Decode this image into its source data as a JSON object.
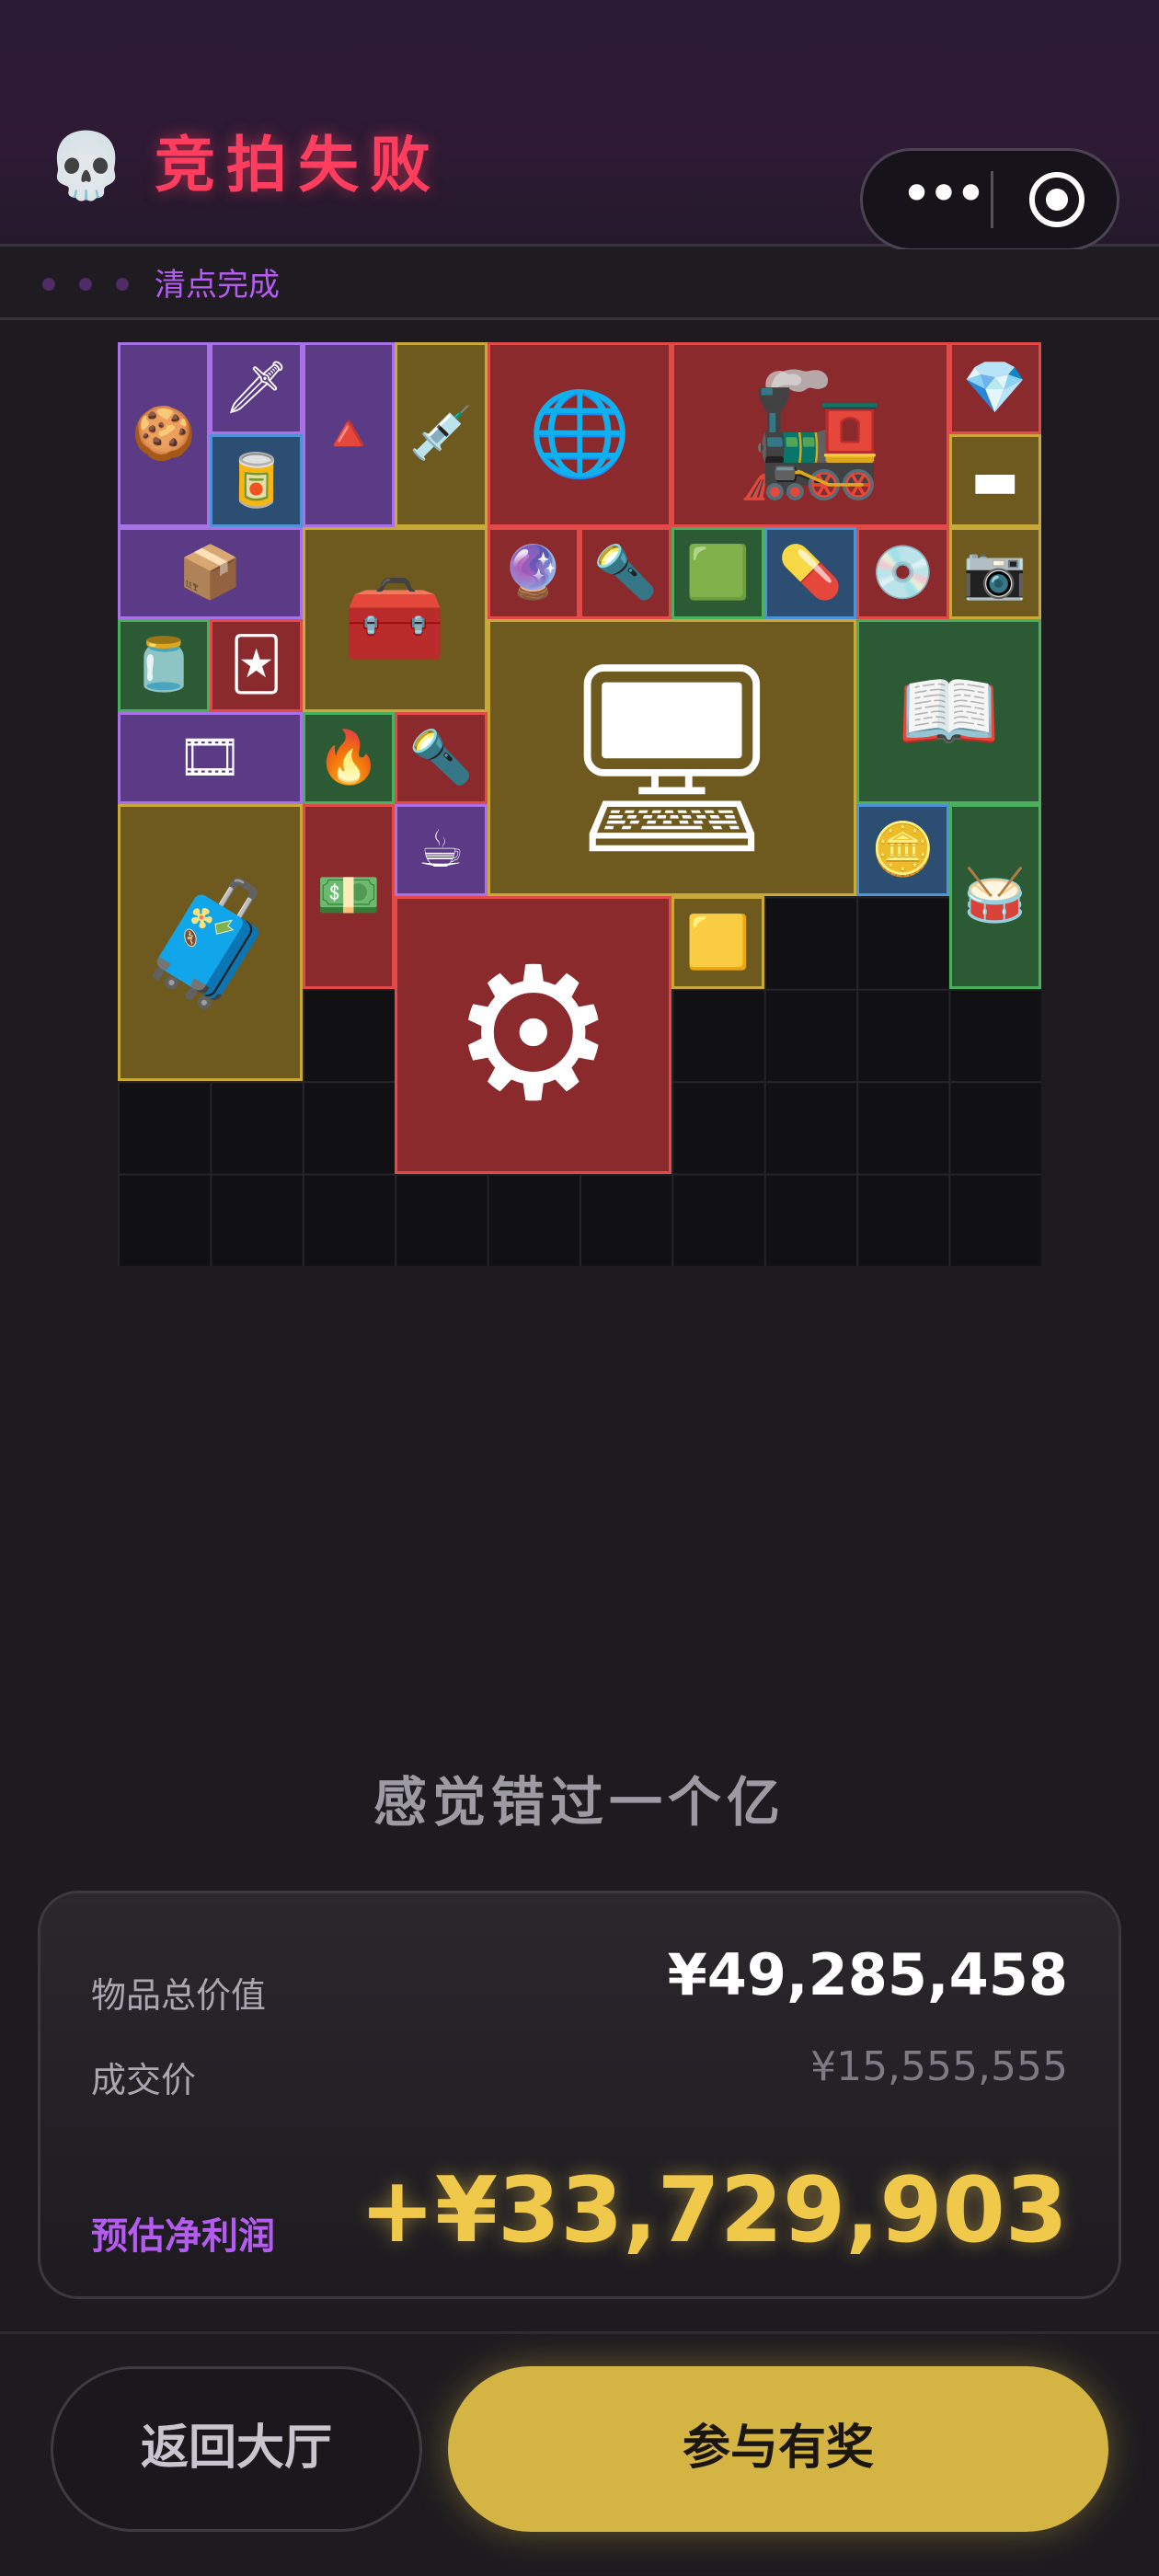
{
  "header": {
    "skull_icon": "💀",
    "title": "竞拍失败",
    "capsule_more": "•••"
  },
  "status": {
    "text": "清点完成"
  },
  "grid": {
    "items": [
      {
        "name": "gingerbread",
        "glyph": "🍪",
        "color": "purple"
      },
      {
        "name": "spearhead",
        "glyph": "🗡",
        "color": "purple"
      },
      {
        "name": "triangle-pendant",
        "glyph": "🔺",
        "color": "purple"
      },
      {
        "name": "capsule-case",
        "glyph": "💉",
        "color": "gold"
      },
      {
        "name": "armillary-sphere",
        "glyph": "🌐",
        "color": "red"
      },
      {
        "name": "red-engine",
        "glyph": "🚂",
        "color": "red"
      },
      {
        "name": "diamond",
        "glyph": "💎",
        "color": "red"
      },
      {
        "name": "ammo-tin",
        "glyph": "🥫",
        "color": "blue"
      },
      {
        "name": "chip-bar",
        "glyph": "▬",
        "color": "gold"
      },
      {
        "name": "gpu-box",
        "glyph": "📦",
        "color": "purple"
      },
      {
        "name": "ammo-crate",
        "glyph": "🧰",
        "color": "gold"
      },
      {
        "name": "marble-orb",
        "glyph": "🔮",
        "color": "red"
      },
      {
        "name": "flashlight",
        "glyph": "🔦",
        "color": "red"
      },
      {
        "name": "circuit-board",
        "glyph": "🟩",
        "color": "green"
      },
      {
        "name": "pill-bottle",
        "glyph": "💊",
        "color": "blue"
      },
      {
        "name": "cd-disc",
        "glyph": "💿",
        "color": "red"
      },
      {
        "name": "camera",
        "glyph": "📷",
        "color": "gold"
      },
      {
        "name": "coffee-jar",
        "glyph": "🫙",
        "color": "green"
      },
      {
        "name": "playing-card",
        "glyph": "🃏",
        "color": "red"
      },
      {
        "name": "server-board",
        "glyph": "🖥",
        "color": "gold"
      },
      {
        "name": "magazine",
        "glyph": "📖",
        "color": "green"
      },
      {
        "name": "graphics-card",
        "glyph": "🎞",
        "color": "purple"
      },
      {
        "name": "lighter",
        "glyph": "🔥",
        "color": "green"
      },
      {
        "name": "flashlight-2",
        "glyph": "🔦",
        "color": "red"
      },
      {
        "name": "hard-case",
        "glyph": "🧳",
        "color": "gold"
      },
      {
        "name": "banknote",
        "glyph": "💵",
        "color": "red"
      },
      {
        "name": "teacup",
        "glyph": "☕",
        "color": "purple"
      },
      {
        "name": "coin",
        "glyph": "🪙",
        "color": "blue"
      },
      {
        "name": "djembe-drum",
        "glyph": "🥁",
        "color": "green"
      },
      {
        "name": "engine-unit",
        "glyph": "⚙",
        "color": "red"
      },
      {
        "name": "gold-lighter",
        "glyph": "🟨",
        "color": "gold"
      }
    ]
  },
  "result": {
    "subtitle": "感觉错过一个亿",
    "total_label": "物品总价值",
    "total_value": "¥49,285,458",
    "deal_label": "成交价",
    "deal_value": "¥15,555,555",
    "profit_label": "预估净利润",
    "profit_value": "+¥33,729,903"
  },
  "buttons": {
    "back": "返回大厅",
    "join": "参与有奖"
  },
  "colors": {
    "title": "#ff3d5f",
    "accent_purple": "#b45cf0",
    "gold": "#f0c94a",
    "button_gold": "#d4b443"
  }
}
